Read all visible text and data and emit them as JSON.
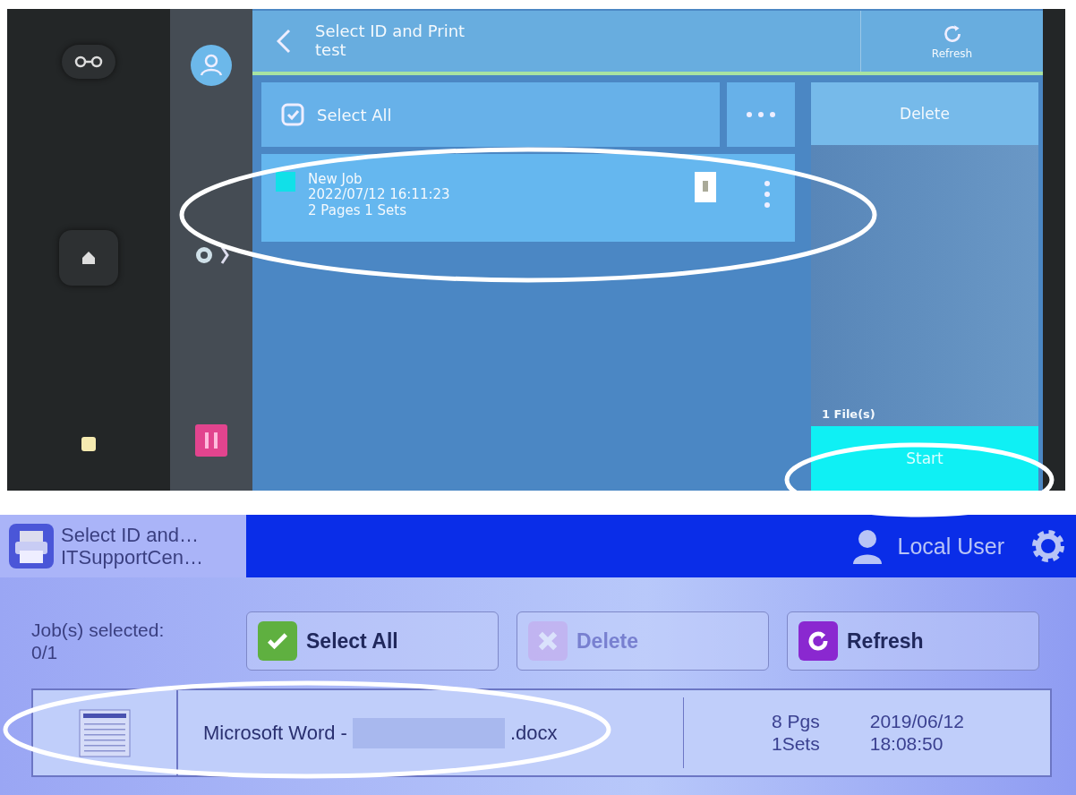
{
  "top_screen": {
    "header": {
      "title": "Select ID and Print",
      "subtitle": "test",
      "refresh_label": "Refresh"
    },
    "select_all_label": "Select All",
    "delete_label": "Delete",
    "job": {
      "name": "New Job",
      "datetime": "2022/07/12 16:11:23",
      "details": "2 Pages 1 Sets",
      "selected": false,
      "color": "#11e0e8"
    },
    "files_count": "1 File(s)",
    "start_label": "Start"
  },
  "bottom_screen": {
    "app_title": "Select ID and…",
    "app_subtitle": "ITSupportCen…",
    "user": "Local User",
    "jobs_selected_label": "Job(s) selected:",
    "jobs_selected_count": "0/1",
    "buttons": [
      {
        "kind": "select",
        "label": "Select All",
        "disabled": false
      },
      {
        "kind": "delete",
        "label": "Delete",
        "disabled": true
      },
      {
        "kind": "refresh",
        "label": "Refresh",
        "disabled": false
      }
    ],
    "job": {
      "name_prefix": "Microsoft Word -",
      "name_suffix": ".docx",
      "pages": "8 Pgs",
      "sets": "1Sets",
      "date": "2019/06/12",
      "time": "18:08:50"
    }
  }
}
